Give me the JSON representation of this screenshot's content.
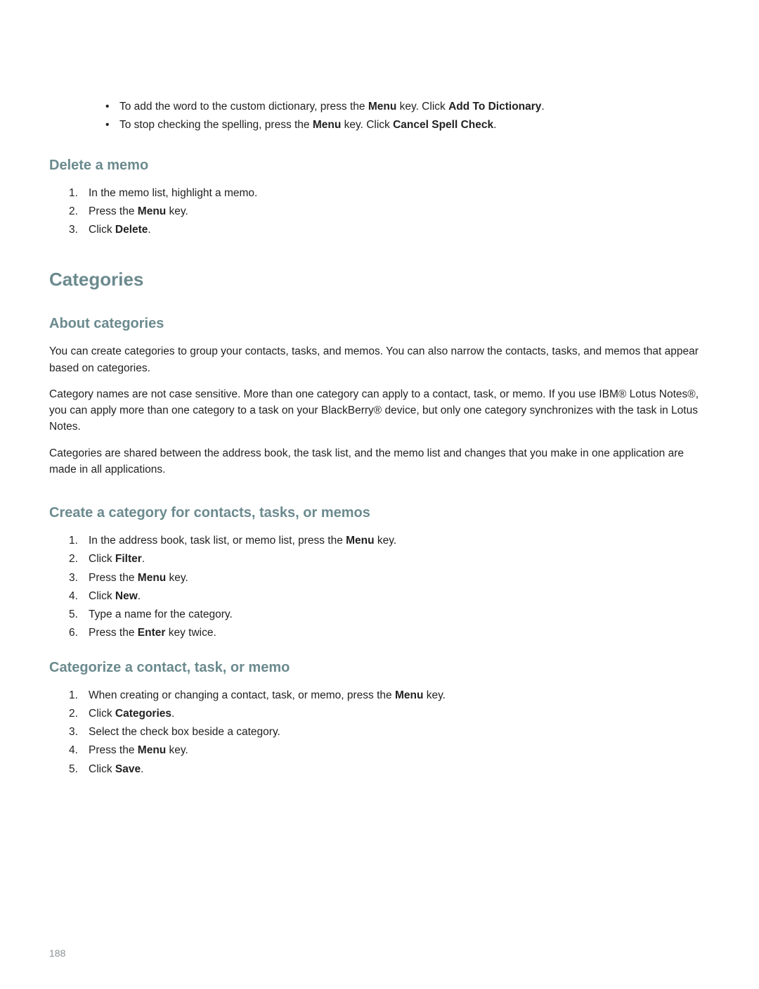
{
  "spellcheck": {
    "bullet1_pre": "To add the word to the custom dictionary, press the ",
    "bullet1_bold1": "Menu",
    "bullet1_mid": " key. Click ",
    "bullet1_bold2": "Add To Dictionary",
    "bullet1_end": ".",
    "bullet2_pre": "To stop checking the spelling, press the ",
    "bullet2_bold1": "Menu",
    "bullet2_mid": " key. Click ",
    "bullet2_bold2": "Cancel Spell Check",
    "bullet2_end": "."
  },
  "delete_memo": {
    "heading": "Delete a memo",
    "step1": "In the memo list, highlight a memo.",
    "step2_pre": "Press the ",
    "step2_bold": "Menu",
    "step2_end": " key.",
    "step3_pre": "Click ",
    "step3_bold": "Delete",
    "step3_end": "."
  },
  "categories": {
    "heading": "Categories",
    "about": {
      "heading": "About categories",
      "p1": "You can create categories to group your contacts, tasks, and memos. You can also narrow the contacts, tasks, and memos that appear based on categories.",
      "p2": "Category names are not case sensitive. More than one category can apply to a contact, task, or memo. If you use IBM® Lotus Notes®, you can apply more than one category to a task on your BlackBerry® device, but only one category synchronizes with the task in Lotus Notes.",
      "p3": "Categories are shared between the address book, the task list, and the memo list and changes that you make in one application are made in all applications."
    },
    "create": {
      "heading": "Create a category for contacts, tasks, or memos",
      "step1_pre": "In the address book, task list, or memo list, press the ",
      "step1_bold": "Menu",
      "step1_end": " key.",
      "step2_pre": "Click ",
      "step2_bold": "Filter",
      "step2_end": ".",
      "step3_pre": "Press the ",
      "step3_bold": "Menu",
      "step3_end": " key.",
      "step4_pre": "Click ",
      "step4_bold": "New",
      "step4_end": ".",
      "step5": "Type a name for the category.",
      "step6_pre": "Press the ",
      "step6_bold": "Enter",
      "step6_end": " key twice."
    },
    "categorize": {
      "heading": "Categorize a contact, task, or memo",
      "step1_pre": "When creating or changing a contact, task, or memo, press the ",
      "step1_bold": "Menu",
      "step1_end": " key.",
      "step2_pre": "Click ",
      "step2_bold": "Categories",
      "step2_end": ".",
      "step3": "Select the check box beside a category.",
      "step4_pre": "Press the ",
      "step4_bold": "Menu",
      "step4_end": " key.",
      "step5_pre": "Click ",
      "step5_bold": "Save",
      "step5_end": "."
    }
  },
  "page_number": "188"
}
